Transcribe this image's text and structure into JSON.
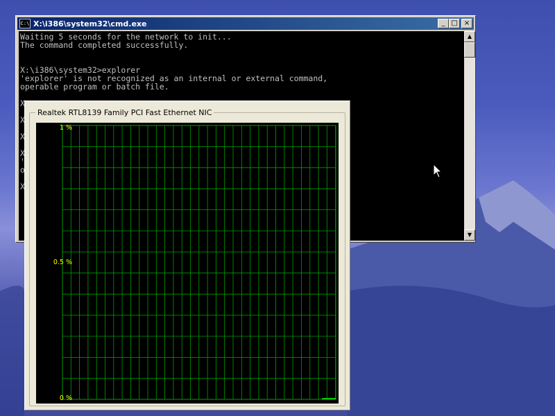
{
  "cmd_window": {
    "title": "X:\\i386\\system32\\cmd.exe",
    "icon_label": "C:\\",
    "buttons": {
      "minimize": "_",
      "maximize": "□",
      "close": "×"
    },
    "lines": [
      "Waiting 5 seconds for the network to init...",
      "The command completed successfully.",
      "",
      "",
      "X:\\i386\\system32>explorer",
      "'explorer' is not recognized as an internal or external command,",
      "operable program or batch file.",
      "",
      "X",
      "",
      "X",
      "",
      "X",
      "",
      "X",
      "'",
      "o",
      "",
      "X"
    ]
  },
  "network_monitor": {
    "title": "Realtek RTL8139 Family PCI Fast Ethernet NIC",
    "y_labels": {
      "top": "1 %",
      "mid": "0.5 %",
      "bottom": "0 %"
    },
    "grid_color": "#00a000",
    "label_color": "#ffff00"
  }
}
